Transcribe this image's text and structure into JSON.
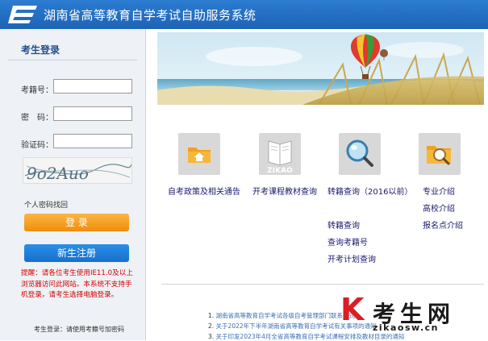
{
  "header": {
    "title": "湖南省高等教育自学考试自助服务系统"
  },
  "login": {
    "title": "考生登录",
    "exam_id_label": "考籍号：",
    "password_label": "密　码：",
    "captcha_label": "验证码：",
    "captcha_text": "9o2Auo",
    "forgot_link": "个人密码找回",
    "login_button": "登 录",
    "register_button": "新生注册",
    "notice": "提醒：请各位考生使用IE11.0及以上浏览器访问此网站。本系统不支持手机登录，请考生选择电脑登录。",
    "footer_note": "考生登录：请使用考籍号加密码"
  },
  "columns": [
    {
      "icon": "folder-home-icon",
      "links": [
        "自考政策及相关通告"
      ]
    },
    {
      "icon": "book-icon",
      "icon_text": "ZIKAO",
      "links": [
        "开考课程教材查询"
      ]
    },
    {
      "icon": "magnifier-icon",
      "links": [
        "转籍查询（2016以前）",
        "转籍查询",
        "查询考籍号",
        "开考计划查询"
      ]
    },
    {
      "icon": "search-folder-icon",
      "links": [
        "专业介绍",
        "高校介绍",
        "报名点介绍"
      ]
    }
  ],
  "news": [
    {
      "num": "1.",
      "text": "湖南省高等教育自学考试各级自考管理部门联系方式"
    },
    {
      "num": "2.",
      "text": "关于2022年下半年湖南省高等教育自学考试有关事项的通知"
    },
    {
      "num": "3.",
      "text": "关于印发2023年4月全省高等教育自学考试课程安排及教材目录的通知"
    }
  ],
  "watermark": {
    "k": "K",
    "text": "考生网",
    "url": "zikaosw.cn"
  },
  "colors": {
    "header": "#1d63b5",
    "login_button": "#f08d0b",
    "register_button": "#1770cc",
    "notice": "#d40000",
    "link": "#1a1a6e"
  }
}
